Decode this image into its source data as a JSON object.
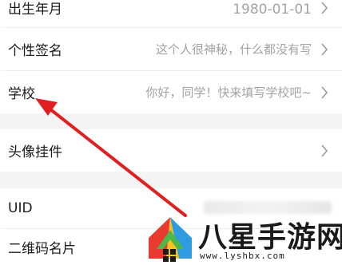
{
  "rows": [
    {
      "label": "出生年月",
      "value": "1980-01-01"
    },
    {
      "label": "个性签名",
      "value": "这个人很神秘，什么都没有写"
    },
    {
      "label": "学校",
      "value": "你好，同学！快来填写学校吧~"
    },
    {
      "label": "头像挂件",
      "value": ""
    },
    {
      "label": "UID",
      "value": ""
    },
    {
      "label": "二维码名片",
      "value": ""
    }
  ],
  "watermark": {
    "logo_text": "八星手游网",
    "url": "www.lyshbx.com"
  },
  "colors": {
    "annotation_arrow": "#e02020",
    "section_gap": "#f4f4f4",
    "value_text": "#a3a3a3"
  }
}
